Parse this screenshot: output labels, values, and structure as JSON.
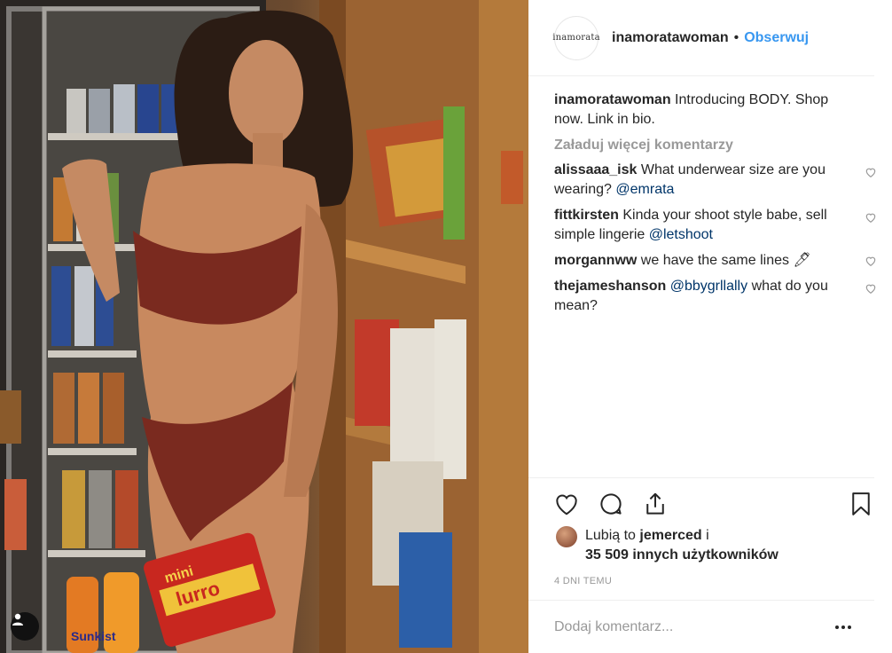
{
  "post": {
    "username": "inamoratawoman",
    "avatar_text": "inamorata",
    "separator": "•",
    "follow_label": "Obserwuj",
    "caption": {
      "author": "inamoratawoman",
      "text": "Introducing BODY. Shop now. Link in bio."
    },
    "load_more_label": "Załaduj więcej komentarzy",
    "comments": [
      {
        "author": "alissaaa_isk",
        "text": "What underwear size are you wearing?",
        "mention": "@emrata",
        "tail": ""
      },
      {
        "author": "fittkirsten",
        "text": "Kinda your shoot style babe, sell simple lingerie",
        "mention": "@letshoot",
        "tail": ""
      },
      {
        "author": "morgannww",
        "text": "we have the same lines 🖊",
        "mention": "",
        "tail": ""
      },
      {
        "author": "thejameshanson",
        "text": "",
        "mention": "@bbygrllally",
        "tail": "what do you mean?"
      }
    ],
    "likes": {
      "prefix": "Lubią to",
      "liker": "jemerced",
      "conj": "i",
      "count_text": "35 509 innych użytkowników"
    },
    "timestamp": "4 DNI TEMU",
    "add_comment_placeholder": "Dodaj komentarz...",
    "photo_text": {
      "can_label_1": "mini",
      "can_label_2": "lurro",
      "shelf_brand": "Sunkist"
    }
  },
  "icons": {
    "like": "heart-icon",
    "comment": "comment-icon",
    "share": "share-icon",
    "save": "bookmark-icon",
    "more": "more-options-icon",
    "user_tag": "user-tag-icon"
  },
  "colors": {
    "link": "#3897f0",
    "mention": "#003569",
    "muted": "#999999",
    "text": "#262626"
  }
}
